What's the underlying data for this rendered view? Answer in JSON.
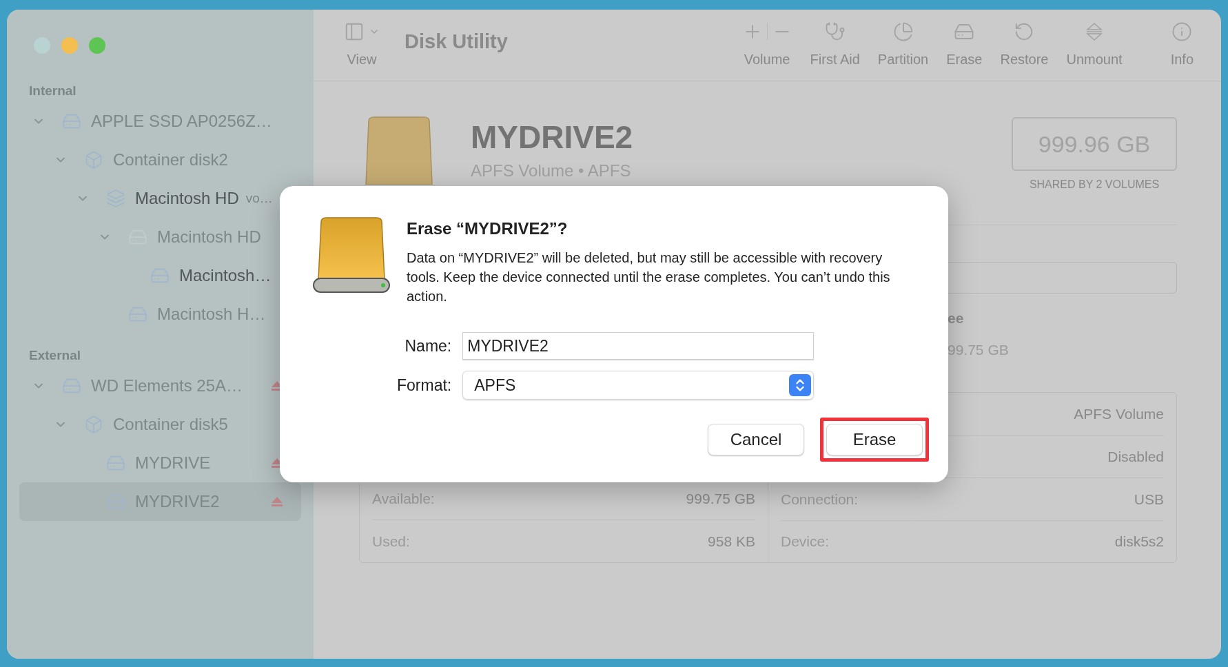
{
  "window": {
    "traffic_lights": [
      {
        "color": "#b9d3d3"
      },
      {
        "color": "#f5bf4f"
      },
      {
        "color": "#5ec453"
      }
    ]
  },
  "sidebar": {
    "sections": [
      {
        "header": "Internal",
        "items": [
          {
            "label": "APPLE SSD AP0256Z…",
            "kind": "disk",
            "expanded": true,
            "dimmed": true,
            "ejectable": false,
            "selected": false,
            "children": [
              {
                "label": "Container disk2",
                "kind": "container",
                "expanded": true,
                "dimmed": true,
                "ejectable": false,
                "selected": false,
                "children": [
                  {
                    "label": "Macintosh HD",
                    "suffix": "vo…",
                    "kind": "stack",
                    "expanded": true,
                    "dimmed": false,
                    "ejectable": false,
                    "selected": false,
                    "children": [
                      {
                        "label": "Macintosh HD",
                        "kind": "faint-disk",
                        "expanded": true,
                        "dimmed": true,
                        "ejectable": false,
                        "selected": false,
                        "children": [
                          {
                            "label": "Macintosh…",
                            "kind": "disk",
                            "dimmed": false,
                            "ejectable": false,
                            "selected": false
                          }
                        ]
                      },
                      {
                        "label": "Macintosh H…",
                        "kind": "disk",
                        "dimmed": true,
                        "ejectable": false,
                        "selected": false
                      }
                    ]
                  }
                ]
              }
            ]
          }
        ]
      },
      {
        "header": "External",
        "items": [
          {
            "label": "WD Elements 25A…",
            "kind": "disk",
            "expanded": true,
            "dimmed": true,
            "ejectable": true,
            "selected": false,
            "children": [
              {
                "label": "Container disk5",
                "kind": "container",
                "expanded": true,
                "dimmed": true,
                "ejectable": false,
                "selected": false,
                "children": [
                  {
                    "label": "MYDRIVE",
                    "kind": "disk",
                    "dimmed": true,
                    "ejectable": true,
                    "selected": false
                  },
                  {
                    "label": "MYDRIVE2",
                    "kind": "disk",
                    "dimmed": true,
                    "ejectable": true,
                    "selected": true
                  }
                ]
              }
            ]
          }
        ]
      }
    ]
  },
  "toolbar": {
    "view_label": "View",
    "title": "Disk Utility",
    "tools": [
      {
        "label": "Volume",
        "kind": "volume"
      },
      {
        "label": "First Aid",
        "kind": "first-aid"
      },
      {
        "label": "Partition",
        "kind": "partition"
      },
      {
        "label": "Erase",
        "kind": "erase"
      },
      {
        "label": "Restore",
        "kind": "restore"
      },
      {
        "label": "Unmount",
        "kind": "unmount"
      },
      {
        "label": "Info",
        "kind": "info"
      }
    ]
  },
  "volume": {
    "name": "MYDRIVE2",
    "subtitle": "APFS Volume • APFS",
    "capacity": "999.96 GB",
    "capacity_note": "SHARED BY 2 VOLUMES",
    "partial_label": "ee",
    "partial_value": "99.75 GB",
    "info_left": [
      {
        "label": "Available:",
        "value": "999.75 GB"
      },
      {
        "label": "Used:",
        "value": "958 KB"
      }
    ],
    "info_right": [
      {
        "value": "APFS Volume"
      },
      {
        "value": "Disabled"
      },
      {
        "label": "Connection:",
        "value": "USB"
      },
      {
        "label": "Device:",
        "value": "disk5s2"
      }
    ]
  },
  "dialog": {
    "title": "Erase “MYDRIVE2”?",
    "message": "Data on “MYDRIVE2” will be deleted, but may still be accessible with recovery tools. Keep the device connected until the erase completes. You can’t undo this action.",
    "name_label": "Name:",
    "name_value": "MYDRIVE2",
    "format_label": "Format:",
    "format_value": "APFS",
    "buttons": [
      {
        "label": "Cancel",
        "highlighted": false
      },
      {
        "label": "Erase",
        "highlighted": true
      }
    ]
  }
}
